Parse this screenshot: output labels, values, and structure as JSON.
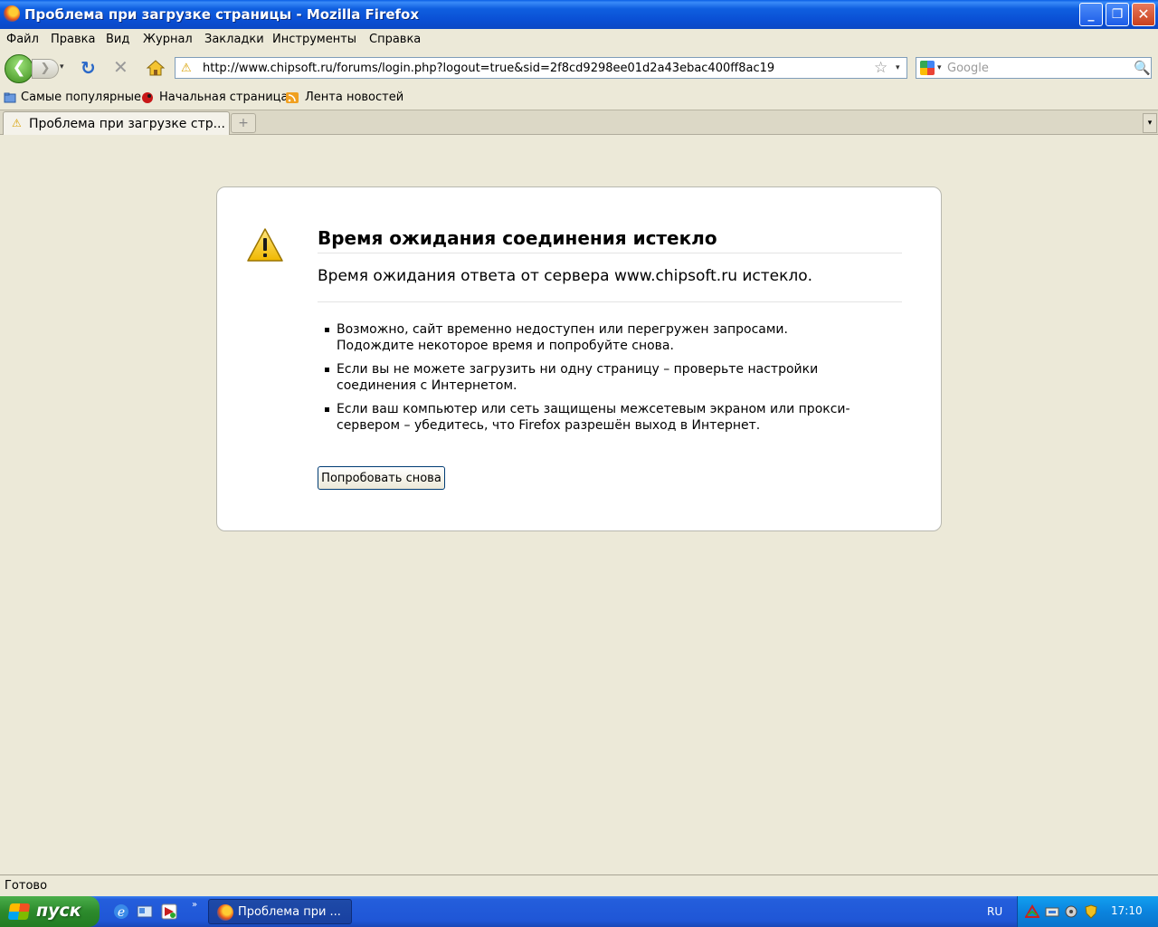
{
  "window": {
    "title": "Проблема при загрузке страницы - Mozilla Firefox",
    "minimize": "_",
    "maximize": "❐",
    "close": "✕"
  },
  "menu": [
    "Файл",
    "Правка",
    "Вид",
    "Журнал",
    "Закладки",
    "Инструменты",
    "Справка"
  ],
  "nav": {
    "back": "❮",
    "forward": "❯",
    "dropdown": "▾",
    "reload": "↻",
    "stop": "✕",
    "url": "http://www.chipsoft.ru/forums/login.php?logout=true&sid=2f8cd9298ee01d2a43ebac400ff8ac19",
    "star": "☆"
  },
  "search": {
    "placeholder": "Google",
    "magnifier": "🔍"
  },
  "bookmarks": [
    "Самые популярные",
    "Начальная страница",
    "Лента новостей"
  ],
  "tabs": {
    "active_label": "Проблема при загрузке стр...",
    "new_tab": "+",
    "list": "▾"
  },
  "error": {
    "title": "Время ожидания соединения истекло",
    "description": "Время ожидания ответа от сервера www.chipsoft.ru истекло.",
    "items": [
      "Возможно, сайт временно недоступен или перегружен запросами. Подождите некоторое время и попробуйте снова.",
      "Если вы не можете загрузить ни одну страницу – проверьте настройки соединения с Интернетом.",
      "Если ваш компьютер или сеть защищены межсетевым экраном или прокси-сервером – убедитесь, что Firefox разрешён выход в Интернет."
    ],
    "retry_label": "Попробовать снова"
  },
  "status": "Готово",
  "taskbar": {
    "start_label": "пуск",
    "more": "»",
    "task_label": "Проблема при ...",
    "lang": "RU",
    "clock": "17:10"
  },
  "icons": {
    "warning": "warning-icon",
    "firefox": "firefox-icon",
    "home": "home-icon",
    "google": "google-icon"
  }
}
